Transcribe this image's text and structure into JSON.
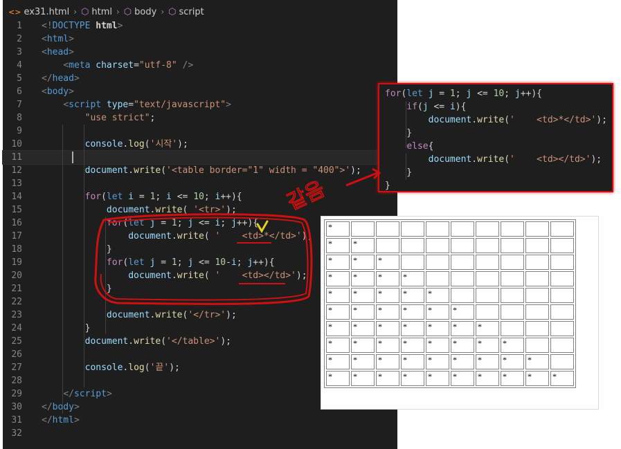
{
  "breadcrumb": {
    "file": "ex31.html",
    "items": [
      "html",
      "body",
      "script"
    ]
  },
  "editor_lines": [
    {
      "n": "1",
      "segs": [
        [
          "p",
          "<!"
        ],
        [
          "t",
          "DOCTYPE"
        ],
        [
          "w",
          " "
        ],
        [
          "b",
          "html"
        ],
        [
          "p",
          ">"
        ]
      ]
    },
    {
      "n": "2",
      "segs": [
        [
          "p",
          "<"
        ],
        [
          "t",
          "html"
        ],
        [
          "p",
          ">"
        ]
      ]
    },
    {
      "n": "3",
      "segs": [
        [
          "p",
          "<"
        ],
        [
          "t",
          "head"
        ],
        [
          "p",
          ">"
        ]
      ]
    },
    {
      "n": "4",
      "segs": [
        [
          "w",
          "    "
        ],
        [
          "p",
          "<"
        ],
        [
          "t",
          "meta"
        ],
        [
          "w",
          " "
        ],
        [
          "a",
          "charset"
        ],
        [
          "w",
          "="
        ],
        [
          "s",
          "\"utf-8\""
        ],
        [
          "w",
          " "
        ],
        [
          "p",
          "/>"
        ]
      ]
    },
    {
      "n": "5",
      "segs": [
        [
          "p",
          "</"
        ],
        [
          "t",
          "head"
        ],
        [
          "p",
          ">"
        ]
      ]
    },
    {
      "n": "6",
      "segs": [
        [
          "p",
          "<"
        ],
        [
          "t",
          "body"
        ],
        [
          "p",
          ">"
        ]
      ]
    },
    {
      "n": "7",
      "segs": [
        [
          "w",
          "    "
        ],
        [
          "p",
          "<"
        ],
        [
          "t",
          "script"
        ],
        [
          "w",
          " "
        ],
        [
          "a",
          "type"
        ],
        [
          "w",
          "="
        ],
        [
          "s",
          "\"text/javascript\""
        ],
        [
          "p",
          ">"
        ]
      ]
    },
    {
      "n": "8",
      "segs": [
        [
          "w",
          "        "
        ],
        [
          "s",
          "\"use strict\""
        ],
        [
          "w",
          ";"
        ]
      ]
    },
    {
      "n": "9",
      "segs": []
    },
    {
      "n": "10",
      "segs": [
        [
          "w",
          "        "
        ],
        [
          "a",
          "console"
        ],
        [
          "w",
          "."
        ],
        [
          "f",
          "log"
        ],
        [
          "w",
          "("
        ],
        [
          "s",
          "'시작'"
        ],
        [
          "w",
          ");"
        ]
      ]
    },
    {
      "n": "11",
      "segs": []
    },
    {
      "n": "12",
      "segs": [
        [
          "w",
          "        "
        ],
        [
          "a",
          "document"
        ],
        [
          "w",
          "."
        ],
        [
          "f",
          "write"
        ],
        [
          "w",
          "("
        ],
        [
          "s",
          "'<table border=\"1\" width = \"400\">'"
        ],
        [
          "w",
          ");"
        ]
      ]
    },
    {
      "n": "13",
      "segs": []
    },
    {
      "n": "14",
      "segs": [
        [
          "w",
          "        "
        ],
        [
          "k",
          "for"
        ],
        [
          "w",
          "("
        ],
        [
          "t",
          "let"
        ],
        [
          "w",
          " "
        ],
        [
          "a",
          "i"
        ],
        [
          "w",
          " = "
        ],
        [
          "n",
          "1"
        ],
        [
          "w",
          "; "
        ],
        [
          "a",
          "i"
        ],
        [
          "w",
          " <= "
        ],
        [
          "n",
          "10"
        ],
        [
          "w",
          "; "
        ],
        [
          "a",
          "i"
        ],
        [
          "w",
          "++){"
        ]
      ]
    },
    {
      "n": "15",
      "segs": [
        [
          "w",
          "            "
        ],
        [
          "a",
          "document"
        ],
        [
          "w",
          "."
        ],
        [
          "f",
          "write"
        ],
        [
          "w",
          "( "
        ],
        [
          "s",
          "'<tr>'"
        ],
        [
          "w",
          ");"
        ]
      ]
    },
    {
      "n": "16",
      "segs": [
        [
          "w",
          "            "
        ],
        [
          "k",
          "for"
        ],
        [
          "w",
          "("
        ],
        [
          "t",
          "let"
        ],
        [
          "w",
          " "
        ],
        [
          "a",
          "j"
        ],
        [
          "w",
          " = "
        ],
        [
          "n",
          "1"
        ],
        [
          "w",
          "; "
        ],
        [
          "a",
          "j"
        ],
        [
          "w",
          " <= "
        ],
        [
          "a",
          "i"
        ],
        [
          "w",
          "; "
        ],
        [
          "a",
          "j"
        ],
        [
          "w",
          "++){"
        ]
      ]
    },
    {
      "n": "17",
      "segs": [
        [
          "w",
          "                "
        ],
        [
          "a",
          "document"
        ],
        [
          "w",
          "."
        ],
        [
          "f",
          "write"
        ],
        [
          "w",
          "( "
        ],
        [
          "s",
          "'    <td>*</td>'"
        ],
        [
          "w",
          ");"
        ]
      ]
    },
    {
      "n": "18",
      "segs": [
        [
          "w",
          "            }"
        ]
      ]
    },
    {
      "n": "19",
      "segs": [
        [
          "w",
          "            "
        ],
        [
          "k",
          "for"
        ],
        [
          "w",
          "("
        ],
        [
          "t",
          "let"
        ],
        [
          "w",
          " "
        ],
        [
          "a",
          "j"
        ],
        [
          "w",
          " = "
        ],
        [
          "n",
          "1"
        ],
        [
          "w",
          "; "
        ],
        [
          "a",
          "j"
        ],
        [
          "w",
          " <= "
        ],
        [
          "n",
          "10"
        ],
        [
          "w",
          "-"
        ],
        [
          "a",
          "i"
        ],
        [
          "w",
          "; "
        ],
        [
          "a",
          "j"
        ],
        [
          "w",
          "++){"
        ]
      ]
    },
    {
      "n": "20",
      "segs": [
        [
          "w",
          "                "
        ],
        [
          "a",
          "document"
        ],
        [
          "w",
          "."
        ],
        [
          "f",
          "write"
        ],
        [
          "w",
          "( "
        ],
        [
          "s",
          "'    <td></td>'"
        ],
        [
          "w",
          ");"
        ]
      ]
    },
    {
      "n": "21",
      "segs": [
        [
          "w",
          "            }"
        ]
      ]
    },
    {
      "n": "22",
      "segs": []
    },
    {
      "n": "23",
      "segs": [
        [
          "w",
          "            "
        ],
        [
          "a",
          "document"
        ],
        [
          "w",
          "."
        ],
        [
          "f",
          "write"
        ],
        [
          "w",
          "("
        ],
        [
          "s",
          "'</tr>'"
        ],
        [
          "w",
          ");"
        ]
      ]
    },
    {
      "n": "24",
      "segs": [
        [
          "w",
          "        }"
        ]
      ]
    },
    {
      "n": "25",
      "segs": [
        [
          "w",
          "        "
        ],
        [
          "a",
          "document"
        ],
        [
          "w",
          "."
        ],
        [
          "f",
          "write"
        ],
        [
          "w",
          "("
        ],
        [
          "s",
          "'</table>'"
        ],
        [
          "w",
          ");"
        ]
      ]
    },
    {
      "n": "26",
      "segs": []
    },
    {
      "n": "27",
      "segs": [
        [
          "w",
          "        "
        ],
        [
          "a",
          "console"
        ],
        [
          "w",
          "."
        ],
        [
          "f",
          "log"
        ],
        [
          "w",
          "("
        ],
        [
          "s",
          "'끝'"
        ],
        [
          "w",
          ");"
        ]
      ]
    },
    {
      "n": "28",
      "segs": []
    },
    {
      "n": "29",
      "segs": [
        [
          "w",
          "    "
        ],
        [
          "p",
          "</"
        ],
        [
          "t",
          "script"
        ],
        [
          "p",
          ">"
        ]
      ]
    },
    {
      "n": "30",
      "segs": [
        [
          "p",
          "</"
        ],
        [
          "t",
          "body"
        ],
        [
          "p",
          ">"
        ]
      ]
    },
    {
      "n": "31",
      "segs": [
        [
          "p",
          "</"
        ],
        [
          "t",
          "html"
        ],
        [
          "p",
          ">"
        ]
      ]
    },
    {
      "n": "32",
      "segs": []
    }
  ],
  "snippet_lines": [
    [
      [
        "k",
        "for"
      ],
      [
        "w",
        "("
      ],
      [
        "t",
        "let"
      ],
      [
        "w",
        " "
      ],
      [
        "a",
        "j"
      ],
      [
        "w",
        " = "
      ],
      [
        "n",
        "1"
      ],
      [
        "w",
        "; "
      ],
      [
        "a",
        "j"
      ],
      [
        "w",
        " <= "
      ],
      [
        "n",
        "10"
      ],
      [
        "w",
        "; "
      ],
      [
        "a",
        "j"
      ],
      [
        "w",
        "++){"
      ]
    ],
    [
      [
        "w",
        "    "
      ],
      [
        "k",
        "if"
      ],
      [
        "w",
        "("
      ],
      [
        "a",
        "j"
      ],
      [
        "w",
        " <= "
      ],
      [
        "a",
        "i"
      ],
      [
        "w",
        "){"
      ]
    ],
    [
      [
        "w",
        "        "
      ],
      [
        "a",
        "document"
      ],
      [
        "w",
        "."
      ],
      [
        "f",
        "write"
      ],
      [
        "w",
        "("
      ],
      [
        "s",
        "'    <td>*</td>'"
      ],
      [
        "w",
        ");"
      ]
    ],
    [
      [
        "w",
        "    }"
      ]
    ],
    [
      [
        "w",
        "    "
      ],
      [
        "k",
        "else"
      ],
      [
        "w",
        "{"
      ]
    ],
    [
      [
        "w",
        "        "
      ],
      [
        "a",
        "document"
      ],
      [
        "w",
        "."
      ],
      [
        "f",
        "write"
      ],
      [
        "w",
        "("
      ],
      [
        "s",
        "'    <td></td>'"
      ],
      [
        "w",
        ");"
      ]
    ],
    [
      [
        "w",
        "    }"
      ]
    ],
    [
      [
        "w",
        "}"
      ]
    ]
  ],
  "annotation_text": "같음",
  "rendered_table": {
    "rows": 10,
    "cols": 10,
    "star": "*",
    "colors": {
      "annotation": "#d01010",
      "highlight": "#e8d020"
    }
  }
}
